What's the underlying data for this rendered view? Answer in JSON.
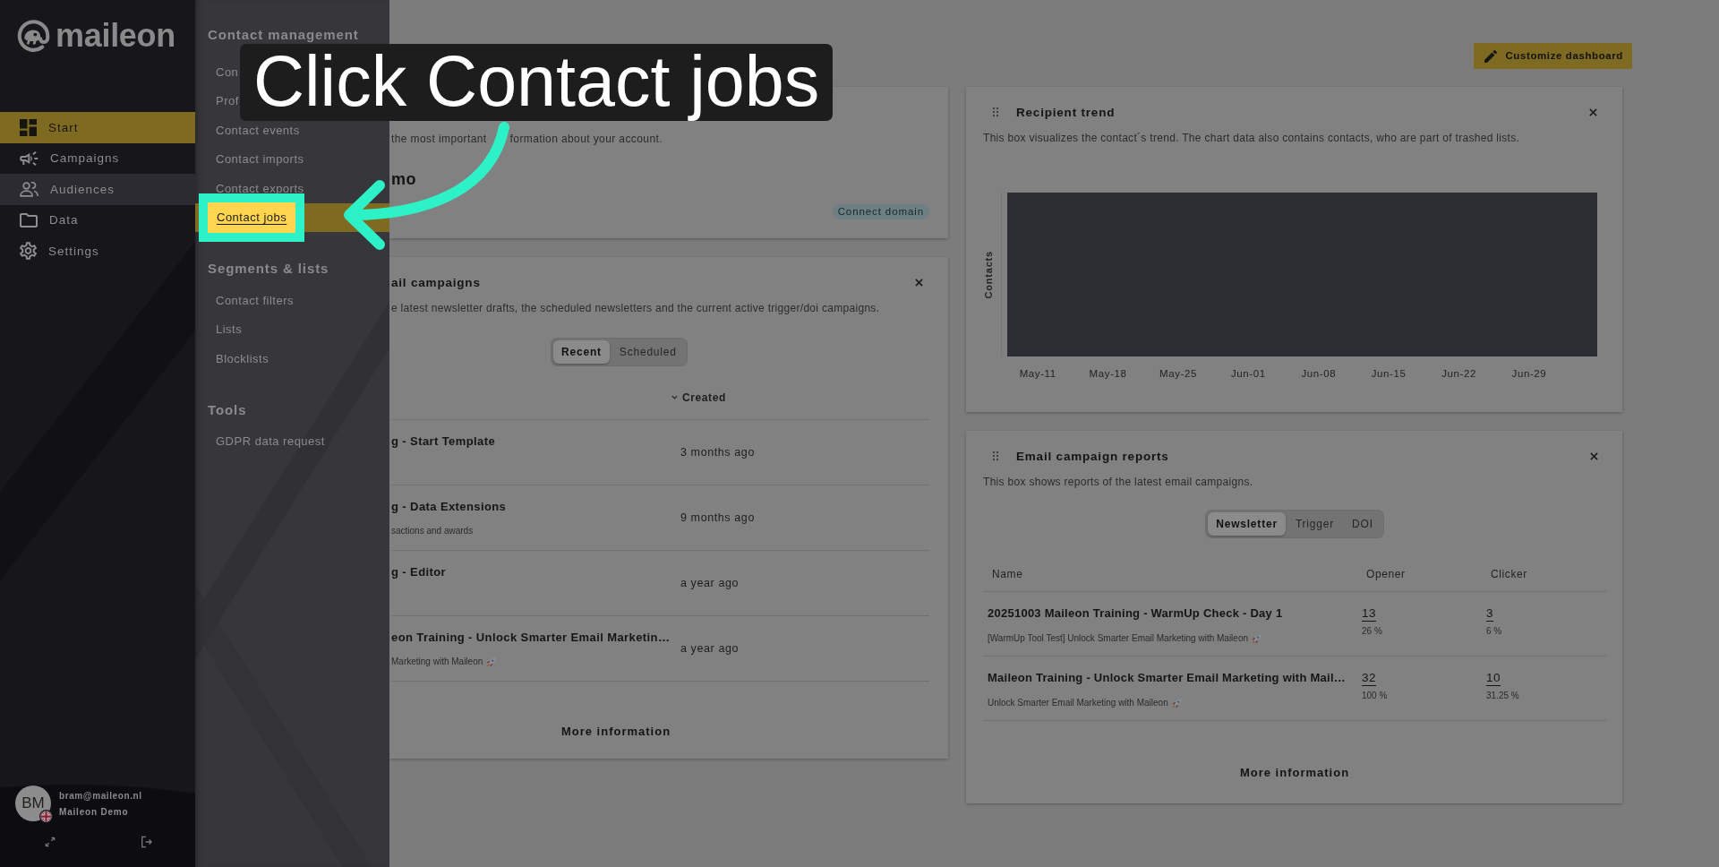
{
  "sidebar": {
    "logo": "maileon",
    "items": [
      {
        "label": "Start",
        "selected": true,
        "expanded": false
      },
      {
        "label": "Campaigns",
        "selected": false,
        "expanded": false
      },
      {
        "label": "Audiences",
        "selected": false,
        "expanded": true
      },
      {
        "label": "Data",
        "selected": false,
        "expanded": false
      },
      {
        "label": "Settings",
        "selected": false,
        "expanded": false
      }
    ],
    "user": {
      "initials": "BM",
      "email": "bram@maileon.nl",
      "account": "Maileon Demo"
    }
  },
  "submenu": {
    "sections": [
      {
        "heading": "Contact management",
        "items": [
          {
            "label": "Con",
            "highlighted": false
          },
          {
            "label": "Prof",
            "highlighted": false
          },
          {
            "label": "Contact events",
            "highlighted": false
          },
          {
            "label": "Contact imports",
            "highlighted": false
          },
          {
            "label": "Contact exports",
            "highlighted": false
          },
          {
            "label": "Contact jobs",
            "highlighted": true
          }
        ]
      },
      {
        "heading": "Segments & lists",
        "items": [
          {
            "label": "Contact filters",
            "highlighted": false
          },
          {
            "label": "Lists",
            "highlighted": false
          },
          {
            "label": "Blocklists",
            "highlighted": false
          }
        ]
      },
      {
        "heading": "Tools",
        "items": [
          {
            "label": "GDPR data request",
            "highlighted": false
          }
        ]
      }
    ]
  },
  "toolbar": {
    "customize_button": "Customize dashboard"
  },
  "account_card": {
    "description": [
      "the most important",
      "formation about your account."
    ],
    "account": "mo",
    "badge": "Connect domain"
  },
  "campaigns_card": {
    "title": "ail campaigns",
    "description": "e latest newsletter drafts, the scheduled newsletters and the current active trigger/doi campaigns.",
    "segments": [
      {
        "label": "Recent",
        "selected": true
      },
      {
        "label": "Scheduled",
        "selected": false
      }
    ],
    "columns": [
      {
        "label": "Created",
        "sorted": true
      }
    ],
    "rows": [
      {
        "title": "g - Start Template",
        "created": "3 months ago"
      },
      {
        "title": "g - Data Extensions",
        "subtitle": "sactions and awards",
        "created": "9 months ago"
      },
      {
        "title": "g - Editor",
        "created": "a year ago"
      },
      {
        "title": "eon Training - Unlock Smarter Email Marketin…",
        "subtitle": "Marketing with Maileon",
        "subtitle_emoji": true,
        "created": "a year ago"
      }
    ],
    "more_link": "More information"
  },
  "trend_card": {
    "title": "Recipient trend",
    "description": "This box visualizes the contact´s trend. The chart data also contains contacts, who are part of trashed lists.",
    "chart": {
      "ylabel": "Contacts",
      "x_labels": [
        "May-11",
        "May-18",
        "May-25",
        "Jun-01",
        "Jun-08",
        "Jun-15",
        "Jun-22",
        "Jun-29"
      ]
    }
  },
  "reports_card": {
    "title": "Email campaign reports",
    "description": "This box shows reports of the latest email campaigns.",
    "segments": [
      {
        "label": "Newsletter",
        "selected": true
      },
      {
        "label": "Trigger",
        "selected": false
      },
      {
        "label": "DOI",
        "selected": false
      }
    ],
    "columns": [
      "Name",
      "Opener",
      "Clicker"
    ],
    "rows": [
      {
        "name": "20251003 Maileon Training - WarmUp Check - Day 1",
        "subject": "[WarmUp Tool Test] Unlock Smarter Email Marketing with Maileon",
        "subject_emoji": true,
        "opener": "13",
        "opener_rate": "26 %",
        "clicker": "3",
        "clicker_rate": "6 %"
      },
      {
        "name": "Maileon Training - Unlock Smarter Email Marketing with Mail…",
        "subject": "Unlock Smarter Email Marketing with Maileon",
        "subject_emoji": true,
        "opener": "32",
        "opener_rate": "100 %",
        "clicker": "10",
        "clicker_rate": "31.25 %"
      }
    ],
    "more_link": "More information"
  },
  "tutorial": {
    "callout": "Click Contact jobs"
  }
}
